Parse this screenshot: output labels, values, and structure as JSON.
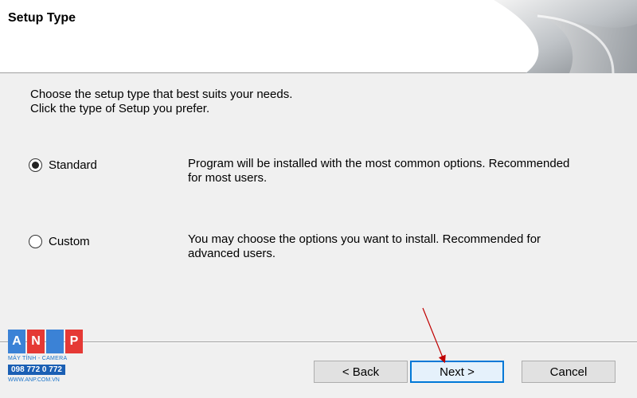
{
  "header": {
    "title": "Setup Type"
  },
  "instructions": {
    "line1": "Choose the setup type that best suits your needs.",
    "line2": "Click the type of Setup you prefer."
  },
  "options": [
    {
      "label": "Standard",
      "selected": true,
      "description_line1": "Program will be installed with the most common options. Recommended",
      "description_line2": "for most users."
    },
    {
      "label": "Custom",
      "selected": false,
      "description_line1": "You may choose the options you want to install. Recommended for",
      "description_line2": "advanced users."
    }
  ],
  "buttons": {
    "back": "< Back",
    "next": "Next >",
    "cancel": "Cancel"
  },
  "watermark": {
    "letters": [
      "A",
      "N",
      "P"
    ],
    "tagline": "MÁY TÍNH - CAMERA",
    "phone": "098 772 0 772",
    "url": "WWW.ANP.COM.VN"
  },
  "colors": {
    "default_button_border": "#0078d7",
    "annotation_arrow": "#c00000"
  }
}
